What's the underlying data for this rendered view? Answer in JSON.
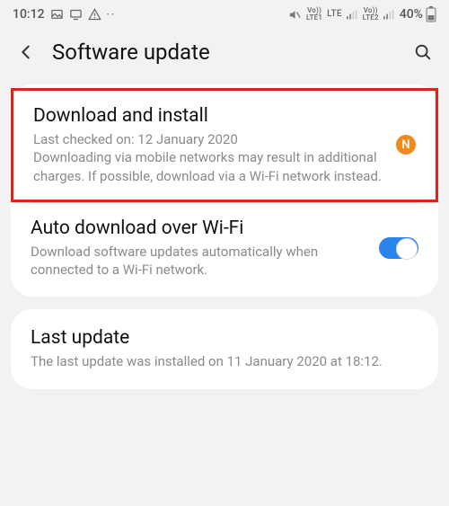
{
  "statusbar": {
    "time": "10:12",
    "battery_pct": "40%",
    "sim1_label": "Vo))\nLTE1",
    "lte_label": "LTE",
    "sim2_label": "Vo))\nLTE2"
  },
  "header": {
    "title": "Software update"
  },
  "card1": {
    "download": {
      "title": "Download and install",
      "desc": "Last checked on: 12 January 2020\nDownloading via mobile networks may result in additional charges. If possible, download via a Wi-Fi network instead.",
      "badge": "N"
    },
    "auto": {
      "title": "Auto download over Wi-Fi",
      "desc": "Download software updates automatically when connected to a Wi-Fi network.",
      "toggle_on": true
    }
  },
  "card2": {
    "last": {
      "title": "Last update",
      "desc": "The last update was installed on 11 January 2020 at 18:12."
    }
  }
}
